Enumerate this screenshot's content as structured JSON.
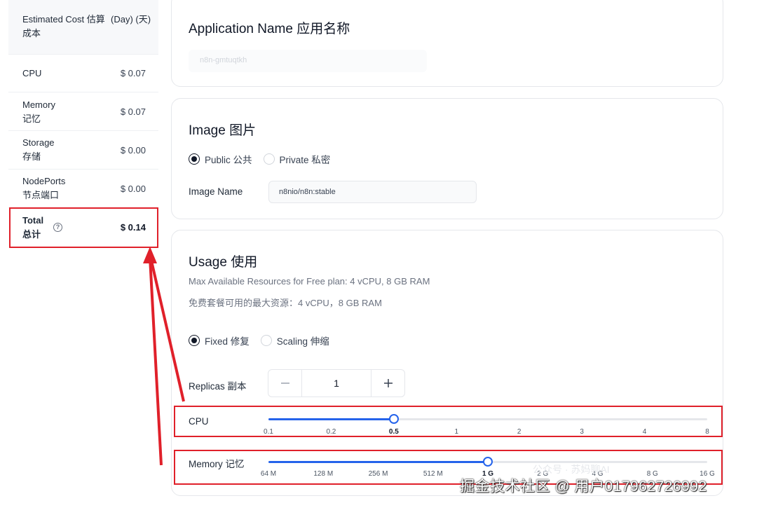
{
  "cost_table": {
    "header": {
      "left": "Estimated Cost 估算成本",
      "right": "(Day) (天)"
    },
    "rows": [
      {
        "label": "CPU",
        "value": "$ 0.07"
      },
      {
        "label": "Memory\n记忆",
        "value": "$ 0.07"
      },
      {
        "label": "Storage\n存储",
        "value": "$ 0.00"
      },
      {
        "label": "NodePorts\n节点端口",
        "value": "$ 0.00"
      }
    ],
    "total": {
      "label": "Total\n总计",
      "value": "$ 0.14",
      "help_icon": "question-circle-icon"
    }
  },
  "app_card": {
    "title": "Application Name 应用名称",
    "input_value": "n8n-gmtuqtkh"
  },
  "image_card": {
    "title": "Image 图片",
    "options": [
      {
        "label": "Public 公共",
        "selected": true
      },
      {
        "label": "Private 私密",
        "selected": false
      }
    ],
    "image_name_label": "Image Name",
    "image_name_value": "n8nio/n8n:stable"
  },
  "usage_card": {
    "title": "Usage 使用",
    "note_en": "Max Available Resources for Free plan: 4 vCPU, 8 GB RAM",
    "note_zh": "免费套餐可用的最大资源：4 vCPU，8 GB RAM",
    "modes": [
      {
        "label": "Fixed 修复",
        "selected": true
      },
      {
        "label": "Scaling 伸缩",
        "selected": false
      }
    ],
    "replicas": {
      "label": "Replicas 副本",
      "value": "1",
      "minus_icon": "minus-icon",
      "plus_icon": "plus-icon"
    },
    "cpu_slider": {
      "label": "CPU",
      "ticks": [
        "0.1",
        "0.2",
        "0.5",
        "1",
        "2",
        "3",
        "4",
        "8"
      ],
      "selected_index": 2
    },
    "memory_slider": {
      "label": "Memory 记忆",
      "ticks": [
        "64 M",
        "128 M",
        "256 M",
        "512 M",
        "1 G",
        "2 G",
        "4 G",
        "8 G",
        "16 G"
      ],
      "selected_index": 4
    }
  },
  "colors": {
    "accent": "#2563eb",
    "highlight": "#e0202a"
  },
  "watermark": {
    "text": "掘金技术社区 @ 用户0179627269​92",
    "faint": "公众号 · 苏妈聊AI"
  }
}
